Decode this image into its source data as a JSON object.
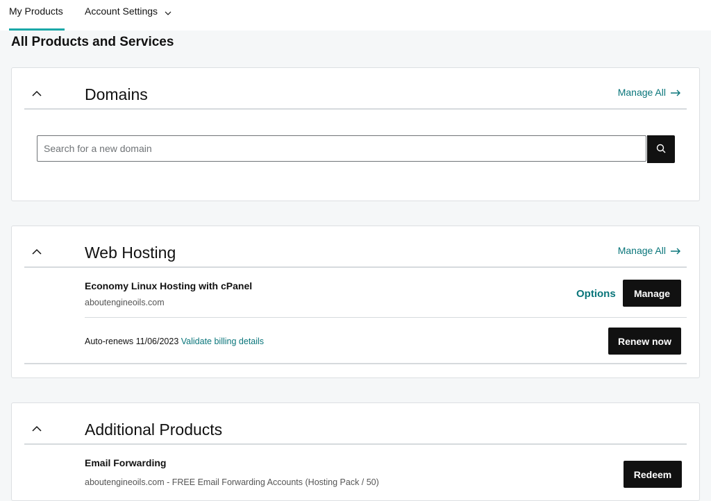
{
  "nav": {
    "tabs": [
      {
        "label": "My Products",
        "active": true
      },
      {
        "label": "Account Settings",
        "active": false
      }
    ]
  },
  "page": {
    "title": "All Products and Services"
  },
  "domains": {
    "title": "Domains",
    "manage_all": "Manage All",
    "search_placeholder": "Search for a new domain"
  },
  "hosting": {
    "title": "Web Hosting",
    "manage_all": "Manage All",
    "product_name": "Economy Linux Hosting with cPanel",
    "domain": "aboutengineoils.com",
    "options_label": "Options",
    "manage_label": "Manage",
    "auto_renew": "Auto-renews 11/06/2023",
    "validate_link": "Validate billing details",
    "renew_label": "Renew now"
  },
  "additional": {
    "title": "Additional Products",
    "product_name": "Email Forwarding",
    "detail": "aboutengineoils.com - FREE Email Forwarding Accounts (Hosting Pack / 50)",
    "redeem_label": "Redeem"
  },
  "colors": {
    "accent": "#1ba8a8",
    "link": "#09757a",
    "button": "#111111"
  },
  "icons": [
    "chevron-down-icon",
    "chevron-up-icon",
    "arrow-right-icon",
    "search-icon"
  ]
}
